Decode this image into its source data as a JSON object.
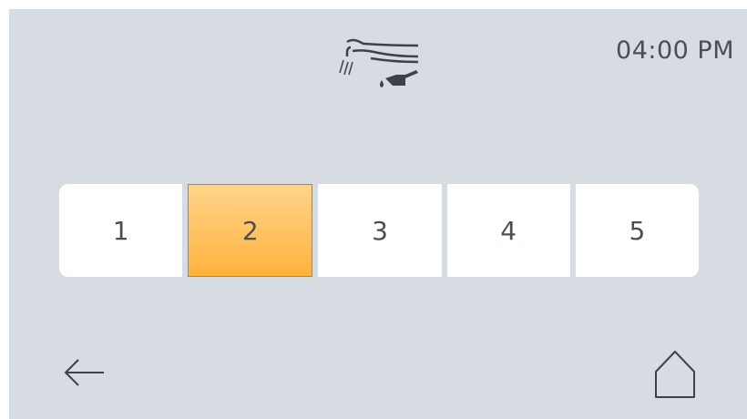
{
  "status": {
    "time": "04:00 PM"
  },
  "header": {
    "mode_icon": "handpiece-oil-icon"
  },
  "selector": {
    "selected_index": 1,
    "options": [
      "1",
      "2",
      "3",
      "4",
      "5"
    ]
  },
  "nav": {
    "back_icon": "arrow-left-icon",
    "home_icon": "home-icon"
  },
  "colors": {
    "background": "#d7dbe2",
    "option_bg": "#ffffff",
    "selected_top": "#ffd48a",
    "selected_bottom": "#ffb23c",
    "text": "#4a4f57"
  }
}
